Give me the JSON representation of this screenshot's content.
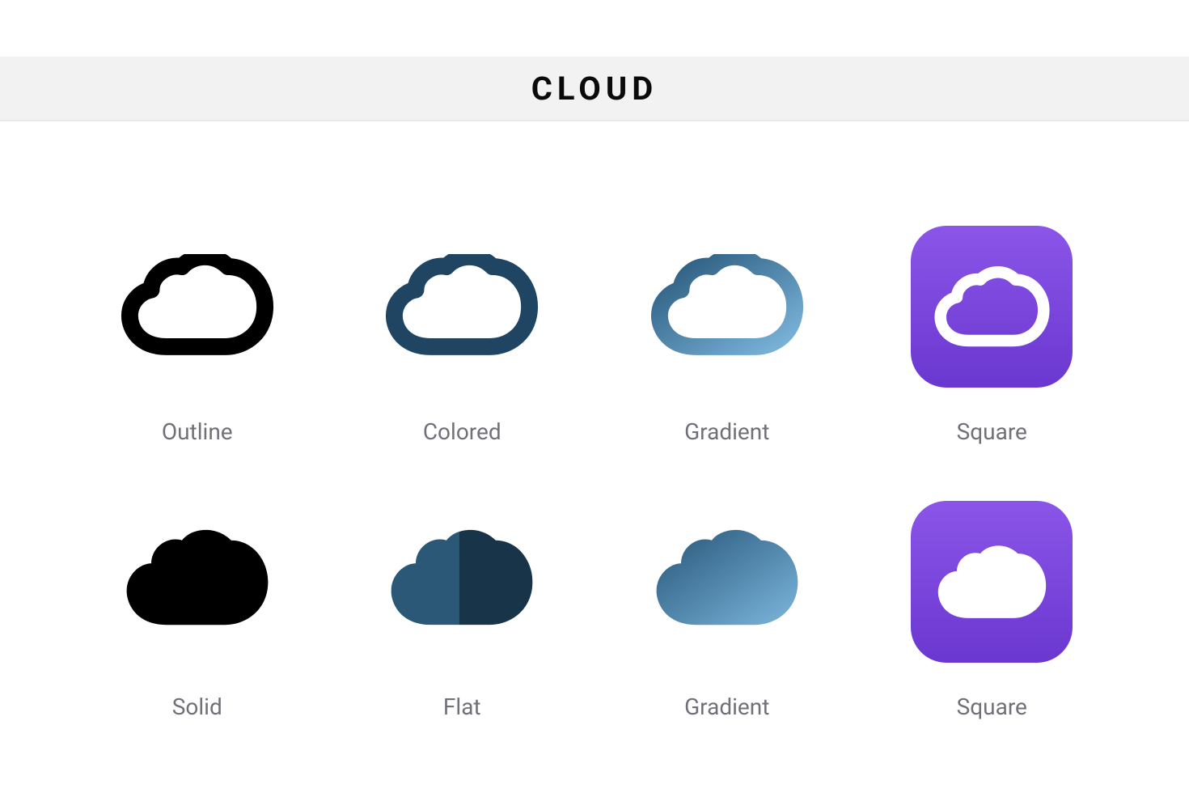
{
  "title": "CLOUD",
  "variants": {
    "row1": [
      {
        "label": "Outline"
      },
      {
        "label": "Colored"
      },
      {
        "label": "Gradient"
      },
      {
        "label": "Square"
      }
    ],
    "row2": [
      {
        "label": "Solid"
      },
      {
        "label": "Flat"
      },
      {
        "label": "Gradient"
      },
      {
        "label": "Square"
      }
    ]
  },
  "colors": {
    "black": "#000000",
    "navy": "#1f4563",
    "navy_light": "#2b5876",
    "grad_dark": "#255578",
    "grad_light": "#6faad2",
    "purple_a": "#8b55e8",
    "purple_b": "#6a37d0",
    "label": "#707079"
  }
}
